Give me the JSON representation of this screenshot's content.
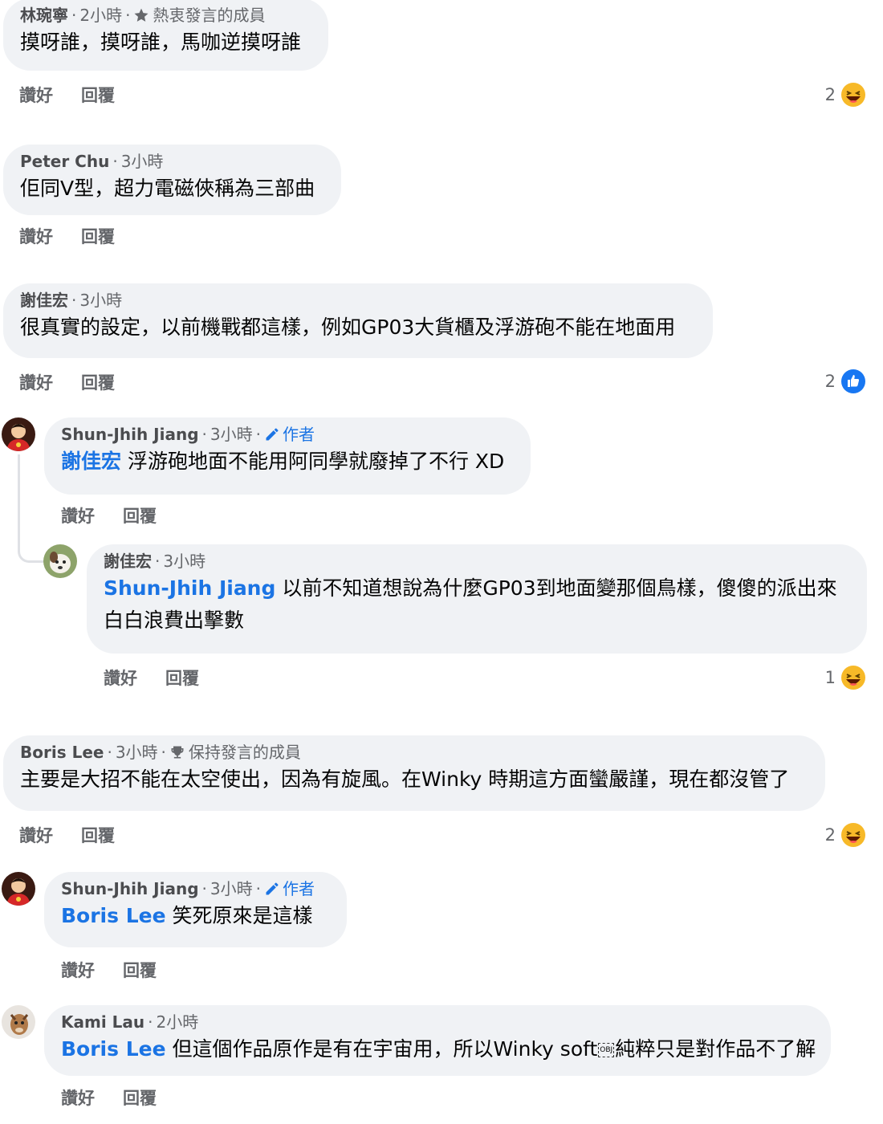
{
  "actions": {
    "like": "讚好",
    "reply": "回覆"
  },
  "c1": {
    "name": "林琬寧",
    "time": "2小時",
    "badge": "熱衷發言的成員",
    "text": "摸呀誰，摸呀誰，馬咖逆摸呀誰",
    "reaction_count": "2"
  },
  "c2": {
    "name": "Peter Chu",
    "time": "3小時",
    "text": "佢同V型，超力電磁俠稱為三部曲"
  },
  "c3": {
    "name": "謝佳宏",
    "time": "3小時",
    "text": "很真實的設定，以前機戰都這樣，例如GP03大貨櫃及浮游砲不能在地面用",
    "reaction_count": "2"
  },
  "r1": {
    "name": "Shun-Jhih Jiang",
    "time": "3小時",
    "author": "作者",
    "mention": "謝佳宏",
    "text": " 浮游砲地面不能用阿同學就廢掉了不行 XD"
  },
  "r2": {
    "name": "謝佳宏",
    "time": "3小時",
    "mention": "Shun-Jhih Jiang",
    "text": " 以前不知道想說為什麼GP03到地面變那個鳥樣，傻傻的派出來白白浪費出擊數",
    "reaction_count": "1"
  },
  "c4": {
    "name": "Boris Lee",
    "time": "3小時",
    "badge": "保持發言的成員",
    "text": "主要是大招不能在太空使出，因為有旋風。在Winky 時期這方面蠻嚴謹，現在都沒管了",
    "reaction_count": "2"
  },
  "r3": {
    "name": "Shun-Jhih Jiang",
    "time": "3小時",
    "author": "作者",
    "mention": "Boris Lee",
    "text": " 笑死原來是這樣"
  },
  "r4": {
    "name": "Kami Lau",
    "time": "2小時",
    "mention": "Boris Lee",
    "text_a": " 但這個作品原作是有在宇宙用，所以Winky soft",
    "obj": "OBJ",
    "text_b": "純粹只是對作品不了解"
  },
  "colors": {
    "bubble": "#f0f2f5",
    "link": "#1b74e4",
    "meta": "#65676b",
    "like_blue": "#1877f2",
    "haha_yellow": "#f7b928"
  }
}
